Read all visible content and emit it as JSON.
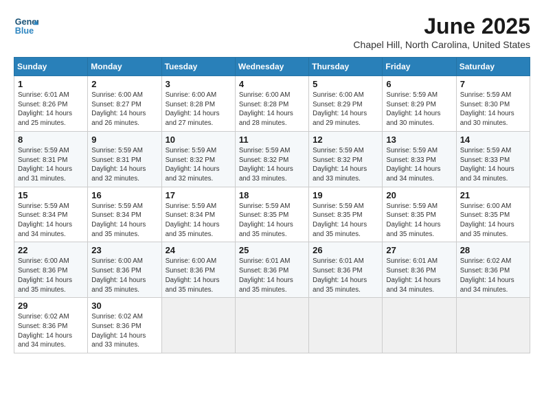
{
  "logo": {
    "line1": "General",
    "line2": "Blue"
  },
  "title": "June 2025",
  "location": "Chapel Hill, North Carolina, United States",
  "weekdays": [
    "Sunday",
    "Monday",
    "Tuesday",
    "Wednesday",
    "Thursday",
    "Friday",
    "Saturday"
  ],
  "weeks": [
    [
      {
        "day": "1",
        "sunrise": "6:01 AM",
        "sunset": "8:26 PM",
        "daylight": "14 hours and 25 minutes."
      },
      {
        "day": "2",
        "sunrise": "6:00 AM",
        "sunset": "8:27 PM",
        "daylight": "14 hours and 26 minutes."
      },
      {
        "day": "3",
        "sunrise": "6:00 AM",
        "sunset": "8:28 PM",
        "daylight": "14 hours and 27 minutes."
      },
      {
        "day": "4",
        "sunrise": "6:00 AM",
        "sunset": "8:28 PM",
        "daylight": "14 hours and 28 minutes."
      },
      {
        "day": "5",
        "sunrise": "6:00 AM",
        "sunset": "8:29 PM",
        "daylight": "14 hours and 29 minutes."
      },
      {
        "day": "6",
        "sunrise": "5:59 AM",
        "sunset": "8:29 PM",
        "daylight": "14 hours and 30 minutes."
      },
      {
        "day": "7",
        "sunrise": "5:59 AM",
        "sunset": "8:30 PM",
        "daylight": "14 hours and 30 minutes."
      }
    ],
    [
      {
        "day": "8",
        "sunrise": "5:59 AM",
        "sunset": "8:31 PM",
        "daylight": "14 hours and 31 minutes."
      },
      {
        "day": "9",
        "sunrise": "5:59 AM",
        "sunset": "8:31 PM",
        "daylight": "14 hours and 32 minutes."
      },
      {
        "day": "10",
        "sunrise": "5:59 AM",
        "sunset": "8:32 PM",
        "daylight": "14 hours and 32 minutes."
      },
      {
        "day": "11",
        "sunrise": "5:59 AM",
        "sunset": "8:32 PM",
        "daylight": "14 hours and 33 minutes."
      },
      {
        "day": "12",
        "sunrise": "5:59 AM",
        "sunset": "8:32 PM",
        "daylight": "14 hours and 33 minutes."
      },
      {
        "day": "13",
        "sunrise": "5:59 AM",
        "sunset": "8:33 PM",
        "daylight": "14 hours and 34 minutes."
      },
      {
        "day": "14",
        "sunrise": "5:59 AM",
        "sunset": "8:33 PM",
        "daylight": "14 hours and 34 minutes."
      }
    ],
    [
      {
        "day": "15",
        "sunrise": "5:59 AM",
        "sunset": "8:34 PM",
        "daylight": "14 hours and 34 minutes."
      },
      {
        "day": "16",
        "sunrise": "5:59 AM",
        "sunset": "8:34 PM",
        "daylight": "14 hours and 35 minutes."
      },
      {
        "day": "17",
        "sunrise": "5:59 AM",
        "sunset": "8:34 PM",
        "daylight": "14 hours and 35 minutes."
      },
      {
        "day": "18",
        "sunrise": "5:59 AM",
        "sunset": "8:35 PM",
        "daylight": "14 hours and 35 minutes."
      },
      {
        "day": "19",
        "sunrise": "5:59 AM",
        "sunset": "8:35 PM",
        "daylight": "14 hours and 35 minutes."
      },
      {
        "day": "20",
        "sunrise": "5:59 AM",
        "sunset": "8:35 PM",
        "daylight": "14 hours and 35 minutes."
      },
      {
        "day": "21",
        "sunrise": "6:00 AM",
        "sunset": "8:35 PM",
        "daylight": "14 hours and 35 minutes."
      }
    ],
    [
      {
        "day": "22",
        "sunrise": "6:00 AM",
        "sunset": "8:36 PM",
        "daylight": "14 hours and 35 minutes."
      },
      {
        "day": "23",
        "sunrise": "6:00 AM",
        "sunset": "8:36 PM",
        "daylight": "14 hours and 35 minutes."
      },
      {
        "day": "24",
        "sunrise": "6:00 AM",
        "sunset": "8:36 PM",
        "daylight": "14 hours and 35 minutes."
      },
      {
        "day": "25",
        "sunrise": "6:01 AM",
        "sunset": "8:36 PM",
        "daylight": "14 hours and 35 minutes."
      },
      {
        "day": "26",
        "sunrise": "6:01 AM",
        "sunset": "8:36 PM",
        "daylight": "14 hours and 35 minutes."
      },
      {
        "day": "27",
        "sunrise": "6:01 AM",
        "sunset": "8:36 PM",
        "daylight": "14 hours and 34 minutes."
      },
      {
        "day": "28",
        "sunrise": "6:02 AM",
        "sunset": "8:36 PM",
        "daylight": "14 hours and 34 minutes."
      }
    ],
    [
      {
        "day": "29",
        "sunrise": "6:02 AM",
        "sunset": "8:36 PM",
        "daylight": "14 hours and 34 minutes."
      },
      {
        "day": "30",
        "sunrise": "6:02 AM",
        "sunset": "8:36 PM",
        "daylight": "14 hours and 33 minutes."
      },
      null,
      null,
      null,
      null,
      null
    ]
  ]
}
